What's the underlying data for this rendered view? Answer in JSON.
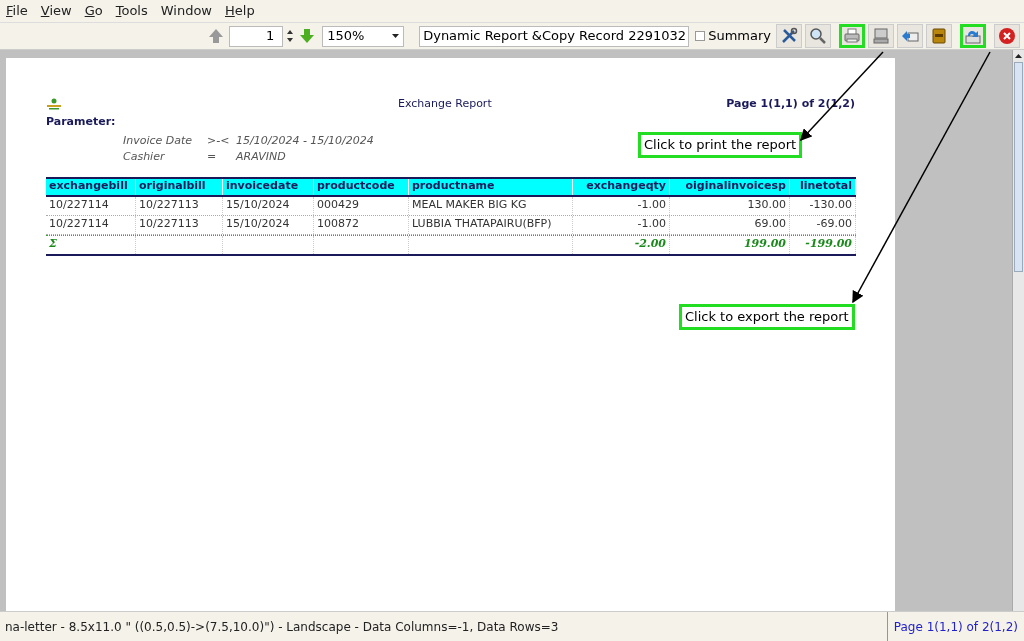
{
  "menu": [
    {
      "label": "File",
      "mnemonic": true
    },
    {
      "label": "View",
      "mnemonic": true
    },
    {
      "label": "Go",
      "mnemonic": true
    },
    {
      "label": "Tools",
      "mnemonic": true
    },
    {
      "label": "Window",
      "mnemonic": false
    },
    {
      "label": "Help",
      "mnemonic": true
    }
  ],
  "toolbar": {
    "page": "1",
    "zoom": "150%",
    "report": "Dynamic Report &Copy Record 2291032",
    "summary": {
      "label": "Summary",
      "checked": false
    },
    "tools": [
      {
        "kind": "tools",
        "highlighted": false
      },
      {
        "kind": "search",
        "highlighted": false
      },
      {
        "kind": "print",
        "highlighted": true
      },
      {
        "kind": "computer",
        "highlighted": false
      },
      {
        "kind": "mail",
        "highlighted": false
      },
      {
        "kind": "archive",
        "highlighted": false
      },
      {
        "kind": "export",
        "highlighted": true
      },
      {
        "kind": "close",
        "highlighted": false
      }
    ]
  },
  "report": {
    "title": "Exchange Report",
    "page": "Page 1(1,1) of 2(1,2)",
    "parameter_label": "Parameter:",
    "parameters": [
      {
        "name": "Invoice Date",
        "op": ">-<",
        "value": "15/10/2024 - 15/10/2024"
      },
      {
        "name": "Cashier",
        "op": "=",
        "value": "ARAVIND"
      }
    ],
    "columns": [
      {
        "label": "exchangebill",
        "numeric": false
      },
      {
        "label": "originalbill",
        "numeric": false
      },
      {
        "label": "invoicedate",
        "numeric": false
      },
      {
        "label": "productcode",
        "numeric": false
      },
      {
        "label": "productname",
        "numeric": false
      },
      {
        "label": "exchangeqty",
        "numeric": true
      },
      {
        "label": "oiginalinvoicesp",
        "numeric": true
      },
      {
        "label": "linetotal",
        "numeric": true
      }
    ],
    "rows": [
      {
        "kind": "data",
        "cells": [
          "10/227114",
          "10/227113",
          "15/10/2024",
          "000429",
          "MEAL MAKER BIG KG",
          "-1.00",
          "130.00",
          "-130.00"
        ]
      },
      {
        "kind": "data",
        "cells": [
          "10/227114",
          "10/227113",
          "15/10/2024",
          "100872",
          "LUBBIA THATAPAIRU(BFP)",
          "-1.00",
          "69.00",
          "-69.00"
        ]
      },
      {
        "kind": "total",
        "cells": [
          "Σ",
          "",
          "",
          "",
          "",
          "-2.00",
          "199.00",
          "-199.00"
        ]
      }
    ]
  },
  "callouts": [
    {
      "text": "Click to print the report"
    },
    {
      "text": "Click to export the report"
    }
  ],
  "status_bar": {
    "info": "na-letter - 8.5x11.0 \" ((0.5,0.5)->(7.5,10.0)\") - Landscape - Data Columns=-1, Data Rows=3",
    "page": "Page 1(1,1) of 2(1,2)"
  }
}
